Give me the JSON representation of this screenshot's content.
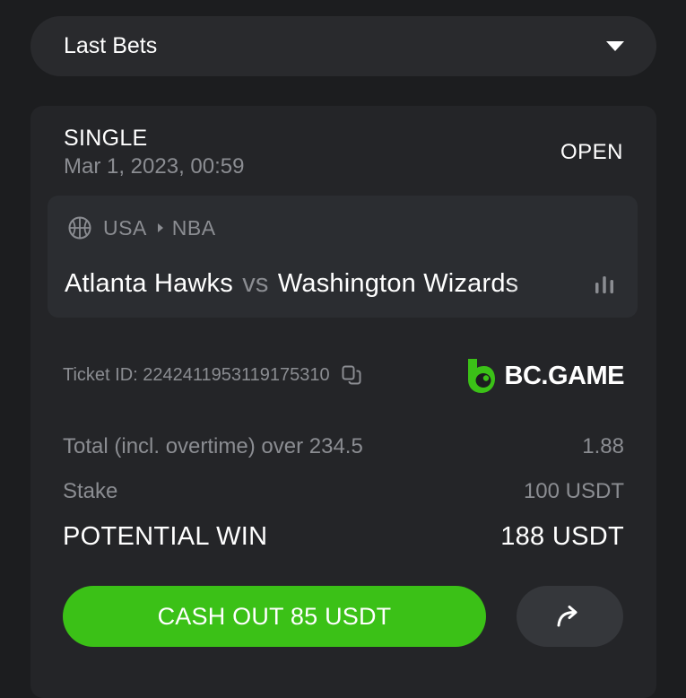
{
  "dropdown": {
    "label": "Last Bets"
  },
  "bet": {
    "type": "SINGLE",
    "date": "Mar 1, 2023, 00:59",
    "status": "OPEN",
    "event": {
      "country": "USA",
      "league": "NBA",
      "home": "Atlanta Hawks",
      "vs": "vs",
      "away": "Washington Wizards"
    },
    "ticket_id": "Ticket ID: 2242411953119175310",
    "brand": "BC.GAME",
    "market": {
      "label": "Total (incl. overtime) over 234.5",
      "odds": "1.88"
    },
    "stake": {
      "label": "Stake",
      "value": "100 USDT"
    },
    "potential_win": {
      "label": "POTENTIAL WIN",
      "value": "188 USDT"
    },
    "cashout_label": "CASH OUT 85 USDT"
  },
  "colors": {
    "accent_green": "#3bc117",
    "muted_text": "#8b8d92",
    "card_bg": "#242528"
  },
  "icons": [
    "chevron-down-icon",
    "basketball-icon",
    "stats-icon",
    "copy-icon",
    "bc-game-logo-icon",
    "share-arrow-icon"
  ]
}
